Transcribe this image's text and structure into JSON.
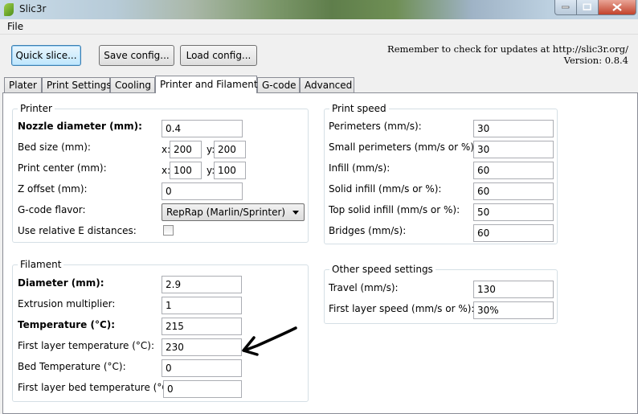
{
  "window": {
    "title": "Slic3r",
    "icon": "slic3r-logo-icon",
    "controls": [
      "minimize-icon",
      "maximize-icon",
      "close-icon"
    ]
  },
  "menu": {
    "file": "File"
  },
  "toolbar": {
    "quick_slice": "Quick slice...",
    "save_config": "Save config...",
    "load_config": "Load config..."
  },
  "notice": {
    "line1": "Remember to check for updates at http://slic3r.org/",
    "line2": "Version: 0.8.4"
  },
  "tabs": [
    "Plater",
    "Print Settings",
    "Cooling",
    "Printer and Filament",
    "G-code",
    "Advanced"
  ],
  "active_tab": "Printer and Filament",
  "printer": {
    "legend": "Printer",
    "nozzle_label": "Nozzle diameter (mm):",
    "nozzle_value": "0.4",
    "bed_label": "Bed size (mm):",
    "bed_x_axis": "x:",
    "bed_x": "200",
    "bed_y_axis": "y:",
    "bed_y": "200",
    "center_label": "Print center (mm):",
    "center_x_axis": "x:",
    "center_x": "100",
    "center_y_axis": "y:",
    "center_y": "100",
    "zoffset_label": "Z offset (mm):",
    "zoffset_value": "0",
    "gcode_label": "G-code flavor:",
    "gcode_value": "RepRap (Marlin/Sprinter)",
    "relative_e_label": "Use relative E distances:",
    "relative_e_checked": false
  },
  "filament": {
    "legend": "Filament",
    "diameter_label": "Diameter (mm):",
    "diameter_value": "2.9",
    "extrusion_label": "Extrusion multiplier:",
    "extrusion_value": "1",
    "temperature_label": "Temperature (°C):",
    "temperature_value": "215",
    "first_layer_temp_label": "First layer temperature (°C):",
    "first_layer_temp_value": "230",
    "bed_temp_label": "Bed Temperature (°C):",
    "bed_temp_value": "0",
    "first_layer_bed_temp_label": "First layer bed temperature (°C):",
    "first_layer_bed_temp_value": "0"
  },
  "print_speed": {
    "legend": "Print speed",
    "perimeters_label": "Perimeters (mm/s):",
    "perimeters_value": "30",
    "small_perimeters_label": "Small perimeters (mm/s or %):",
    "small_perimeters_value": "30",
    "infill_label": "Infill (mm/s):",
    "infill_value": "60",
    "solid_infill_label": "Solid infill (mm/s or %):",
    "solid_infill_value": "60",
    "top_solid_infill_label": "Top solid infill (mm/s or %):",
    "top_solid_infill_value": "50",
    "bridges_label": "Bridges (mm/s):",
    "bridges_value": "60"
  },
  "other_speed": {
    "legend": "Other speed settings",
    "travel_label": "Travel (mm/s):",
    "travel_value": "130",
    "first_layer_speed_label": "First layer speed (mm/s or %):",
    "first_layer_speed_value": "30%"
  },
  "annotation": {
    "icon": "hand-drawn-arrow-icon",
    "color": "#000000"
  }
}
